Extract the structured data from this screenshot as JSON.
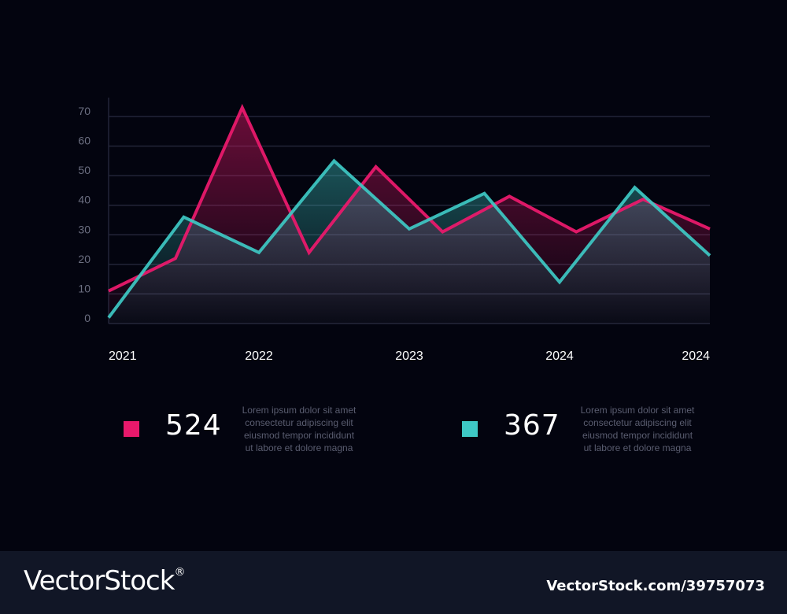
{
  "colors": {
    "background": "#03040f",
    "series_pink": "#e8196b",
    "series_teal": "#3ec9c4",
    "grid": "#232538",
    "tick_text": "#6b6e80"
  },
  "chart_data": {
    "type": "area",
    "x_tick_labels": [
      "2021",
      "2022",
      "2023",
      "2024",
      "2024"
    ],
    "y_ticks": [
      0,
      10,
      20,
      30,
      40,
      50,
      60,
      70
    ],
    "ylim": [
      0,
      70
    ],
    "x": [
      0,
      1,
      2,
      3,
      4,
      5,
      6,
      7,
      8,
      9
    ],
    "grid": true,
    "series": [
      {
        "color": "#e8196b",
        "values": [
          11,
          22,
          73,
          24,
          53,
          31,
          43,
          31,
          42,
          32
        ]
      },
      {
        "color": "#3ec9c4",
        "values": [
          2,
          36,
          24,
          55,
          32,
          44,
          14,
          46,
          23
        ]
      }
    ]
  },
  "stats": [
    {
      "value": "524",
      "color": "#e8196b",
      "description": [
        "Lorem ipsum dolor sit amet",
        "consectetur adipiscing elit",
        "eiusmod tempor  incididunt",
        "ut labore et dolore magna"
      ]
    },
    {
      "value": "367",
      "color": "#3ec9c4",
      "description": [
        "Lorem ipsum dolor sit amet",
        "consectetur adipiscing elit",
        "eiusmod tempor  incididunt",
        "ut labore et dolore magna"
      ]
    }
  ],
  "footer": {
    "logo_text": "VectorStock",
    "logo_mark": "®",
    "image_id": "VectorStock.com/39757073"
  }
}
